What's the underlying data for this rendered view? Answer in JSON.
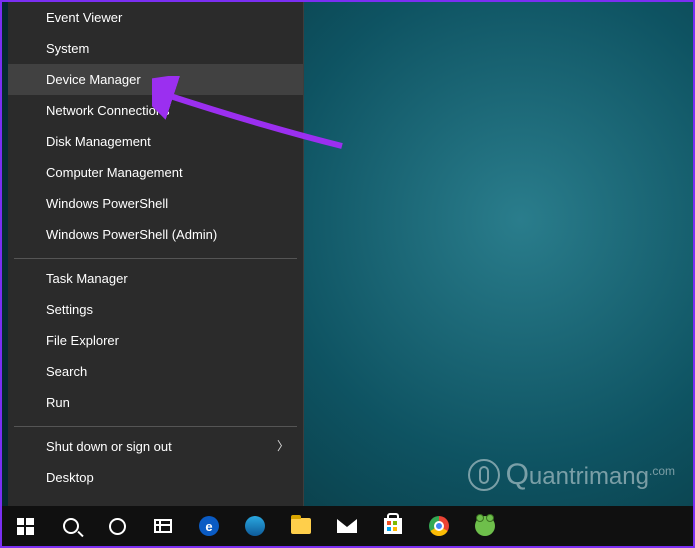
{
  "menu": {
    "group1": [
      "Event Viewer",
      "System",
      "Device Manager",
      "Network Connections",
      "Disk Management",
      "Computer Management",
      "Windows PowerShell",
      "Windows PowerShell (Admin)"
    ],
    "group2": [
      "Task Manager",
      "Settings",
      "File Explorer",
      "Search",
      "Run"
    ],
    "group3": {
      "shutdown": "Shut down or sign out",
      "desktop": "Desktop"
    },
    "highlighted_index": 2
  },
  "taskbar": {
    "items": [
      {
        "name": "start-button",
        "icon": "win"
      },
      {
        "name": "search-button",
        "icon": "mag"
      },
      {
        "name": "cortana-button",
        "icon": "ring"
      },
      {
        "name": "taskview-button",
        "icon": "taskview"
      },
      {
        "name": "edge-app",
        "icon": "edge"
      },
      {
        "name": "dev-app",
        "icon": "orb"
      },
      {
        "name": "file-explorer-app",
        "icon": "folder"
      },
      {
        "name": "mail-app",
        "icon": "mail"
      },
      {
        "name": "store-app",
        "icon": "store"
      },
      {
        "name": "chrome-app",
        "icon": "chrome"
      },
      {
        "name": "basecamp-app",
        "icon": "frog"
      }
    ]
  },
  "watermark": {
    "text": "uantrimang",
    "suffix": ".com"
  },
  "annotation": {
    "target": "Device Manager",
    "arrow_color": "#9b2ff0"
  }
}
